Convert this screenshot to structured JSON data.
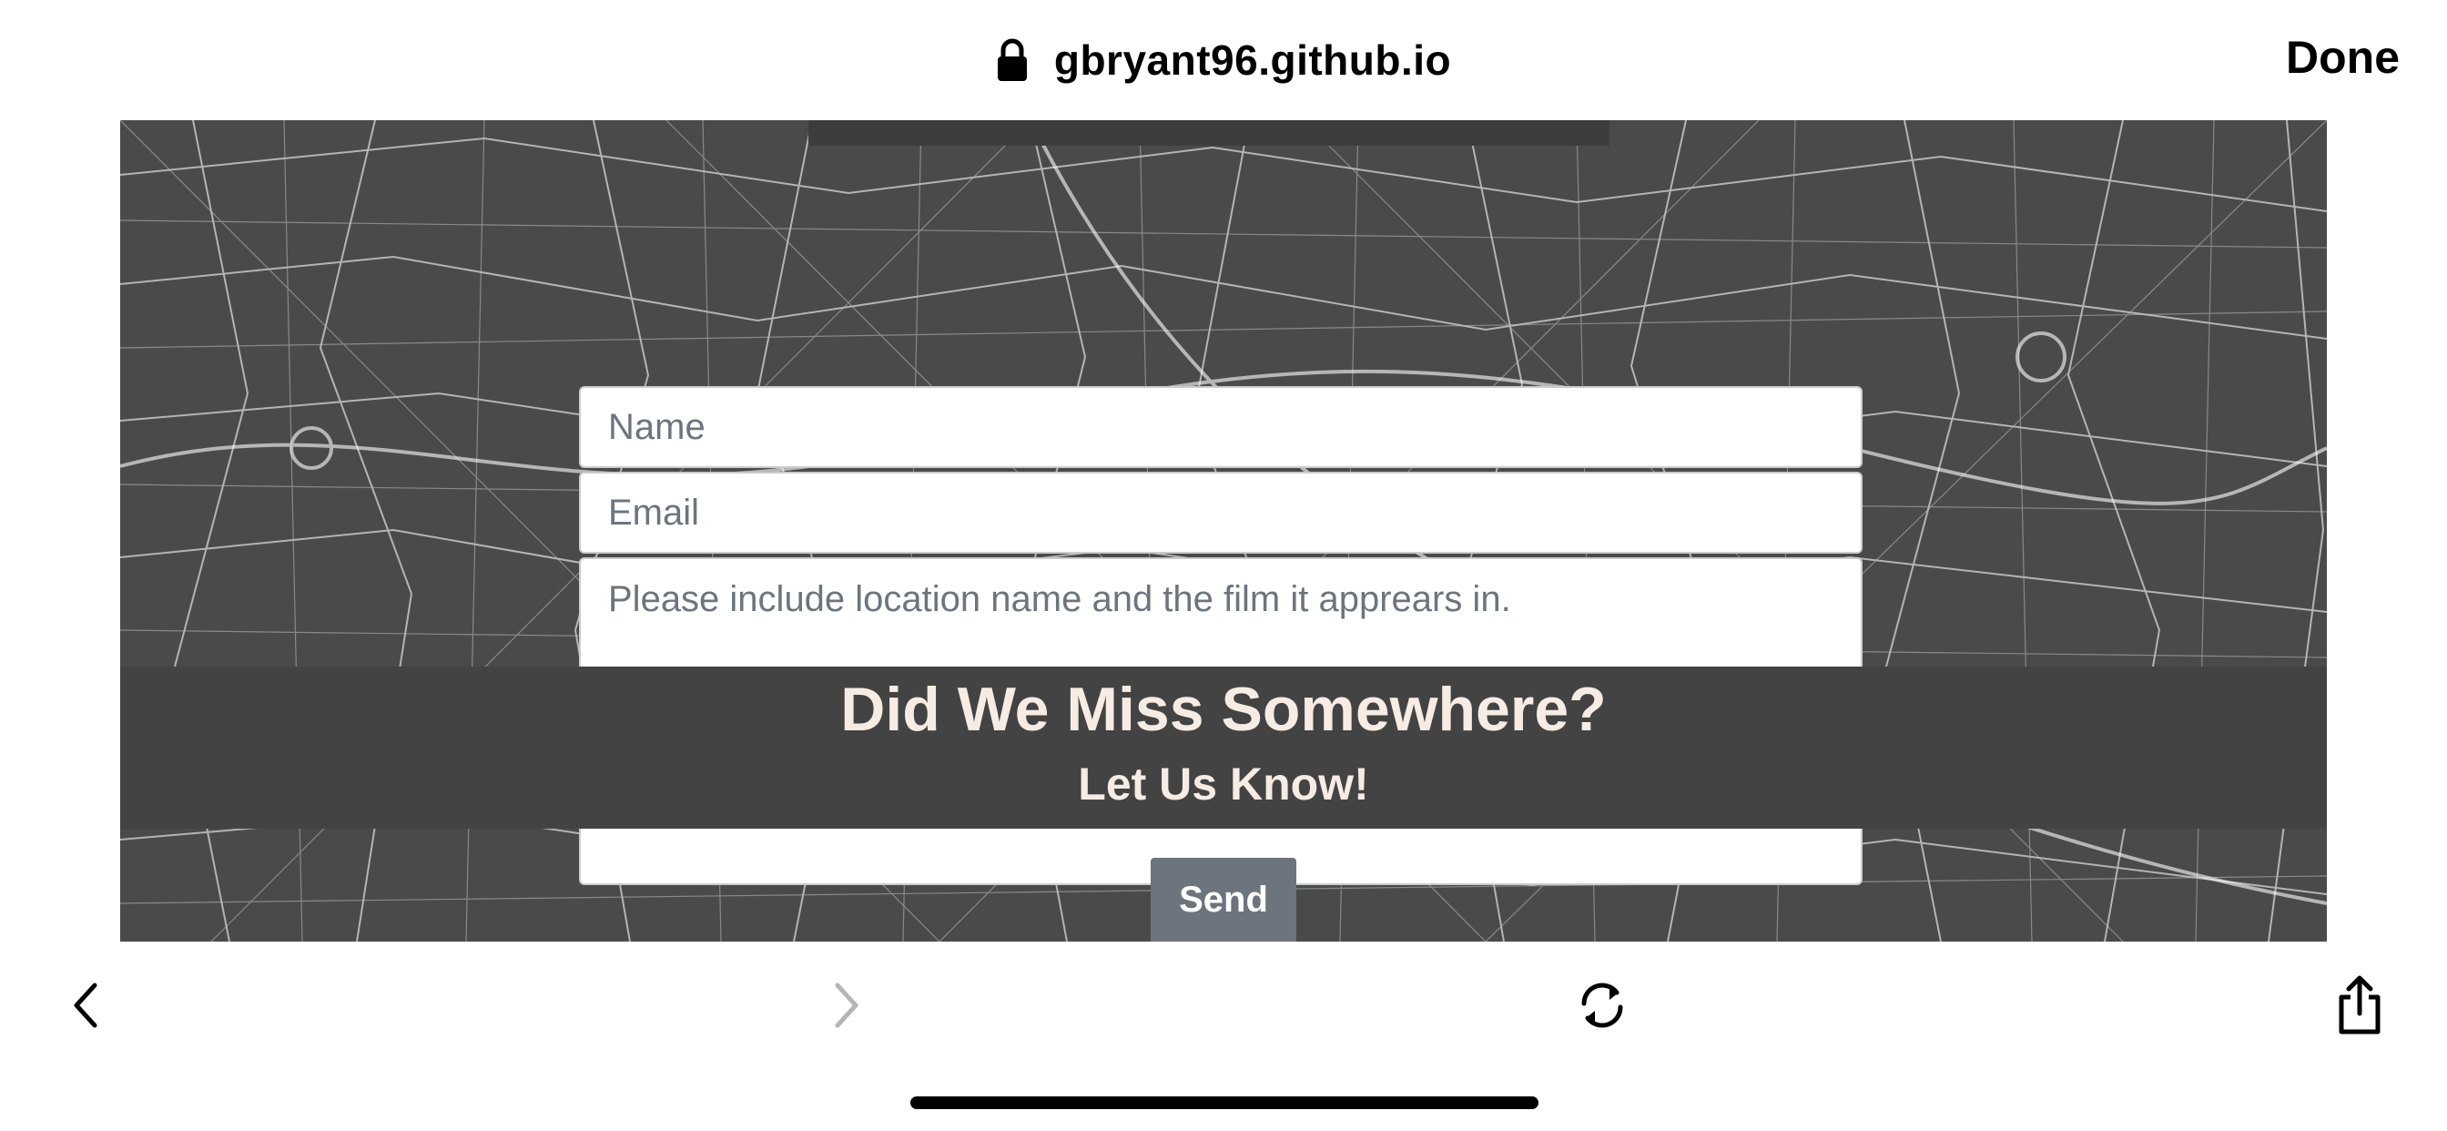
{
  "browser": {
    "url": "gbryant96.github.io",
    "done_label": "Done"
  },
  "form": {
    "name_placeholder": "Name",
    "email_placeholder": "Email",
    "message_placeholder": "Please include location name and the film it apprears in.",
    "send_label": "Send"
  },
  "banner": {
    "title": "Did We Miss Somewhere?",
    "subtitle": "Let Us Know!"
  },
  "toolbar": {
    "icons": [
      "chevron-left-icon",
      "chevron-right-icon",
      "reload-icon",
      "share-icon"
    ]
  },
  "colors": {
    "map_background": "#4a4a4a",
    "banner_background": "#434343",
    "banner_text": "#f6ece4",
    "send_button": "#6c757d",
    "disabled_icon": "#b5b5b5"
  }
}
